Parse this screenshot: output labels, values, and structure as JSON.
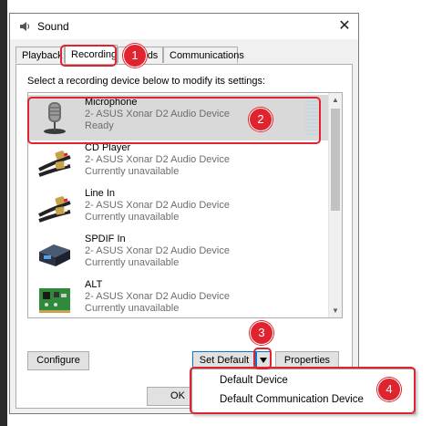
{
  "window": {
    "title": "Sound",
    "close_glyph": "✕"
  },
  "tabs": [
    {
      "label": "Playback",
      "active": false
    },
    {
      "label": "Recording",
      "active": true
    },
    {
      "label": "Sounds",
      "active": false
    },
    {
      "label": "Communications",
      "active": false
    }
  ],
  "instruction": "Select a recording device below to modify its settings:",
  "devices": [
    {
      "name": "Microphone",
      "adapter": "2- ASUS Xonar D2 Audio Device",
      "status": "Ready",
      "icon": "microphone-icon",
      "selected": true
    },
    {
      "name": "CD Player",
      "adapter": "2- ASUS Xonar D2 Audio Device",
      "status": "Currently unavailable",
      "icon": "rca-cable-icon",
      "selected": false
    },
    {
      "name": "Line In",
      "adapter": "2- ASUS Xonar D2 Audio Device",
      "status": "Currently unavailable",
      "icon": "rca-cable-icon",
      "selected": false
    },
    {
      "name": "SPDIF In",
      "adapter": "2- ASUS Xonar D2 Audio Device",
      "status": "Currently unavailable",
      "icon": "spdif-box-icon",
      "selected": false
    },
    {
      "name": "ALT",
      "adapter": "2- ASUS Xonar D2 Audio Device",
      "status": "Currently unavailable",
      "icon": "sound-card-icon",
      "selected": false
    }
  ],
  "buttons": {
    "configure": "Configure",
    "set_default": "Set Default",
    "properties": "Properties",
    "ok": "OK"
  },
  "dropdown_menu": {
    "items": [
      "Default Device",
      "Default Communication Device"
    ]
  },
  "annotations": {
    "badges": [
      "1",
      "2",
      "3",
      "4"
    ],
    "highlight_color": "#e0242f"
  },
  "colors": {
    "selection": "#d9d9d9",
    "focus_border": "#0078d7"
  }
}
